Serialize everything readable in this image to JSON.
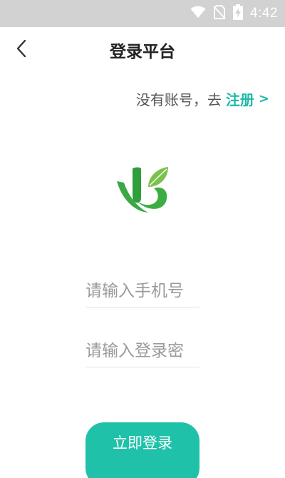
{
  "status_bar": {
    "time": "4:42",
    "icons": [
      "wifi-icon",
      "no-sim-icon",
      "battery-charging-icon"
    ]
  },
  "header": {
    "title": "登录平台",
    "back_icon": "chevron-left-icon"
  },
  "register": {
    "prompt": "没有账号，去",
    "link_label": "注册",
    "arrow": ">"
  },
  "logo": {
    "icon": "brand-leaf-logo-icon",
    "colors": {
      "dark_green": "#2e9f3a",
      "light_green": "#6cc24a"
    }
  },
  "form": {
    "phone_placeholder": "请输入手机号",
    "phone_value": "",
    "password_placeholder": "请输入登录密",
    "password_value": ""
  },
  "login_button": {
    "label": "立即登录"
  },
  "colors": {
    "accent": "#1fc1a9",
    "link": "#1db9a8",
    "status_bar_bg": "#d2d2d2"
  }
}
